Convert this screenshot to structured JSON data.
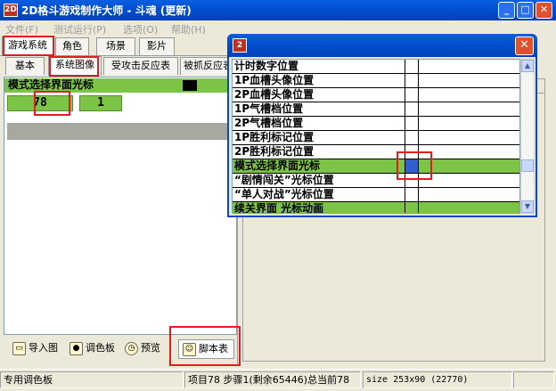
{
  "window": {
    "title": "2D格斗游戏制作大师 - 斗魂 (更新)",
    "icon_label": "2D",
    "controls": {
      "minimize": "_",
      "maximize": "□",
      "close": "✕"
    }
  },
  "menu": {
    "items": [
      "文件(F)",
      "测试运行(P)",
      "选项(O)",
      "帮助(H)"
    ]
  },
  "main_tabs": [
    "游戏系统",
    "角色",
    "场景",
    "影片"
  ],
  "sub_tabs": [
    "基本",
    "系统图像",
    "受攻击反应表",
    "被抓反应表"
  ],
  "left_panel": {
    "header": "模式选择界面光标",
    "value_primary": "78",
    "value_secondary": "1"
  },
  "bottom_tools": {
    "import": "导入图",
    "palette": "调色板",
    "preview": "预览",
    "script": "脚本表"
  },
  "status": {
    "palette": "专用调色板",
    "project": "项目78 步骤1(剩余65446)总当前78",
    "size": "size 253x90 (22770)"
  },
  "popup": {
    "icon_label": "2",
    "close": "✕",
    "rows": [
      "计时数字位置",
      "1P血槽头像位置",
      "2P血槽头像位置",
      "1P气槽档位置",
      "2P气槽档位置",
      "1P胜利标记位置",
      "2P胜利标记位置",
      "模式选择界面光标",
      "“剧情闯关”光标位置",
      "“单人对战”光标位置",
      "续关界面 光标动画"
    ],
    "selected_row": 7
  },
  "colors": {
    "accent_green": "#7cc445",
    "title_blue": "#0350d0",
    "highlight_red": "#e51c1c",
    "selected_cell": "#3060d0"
  }
}
